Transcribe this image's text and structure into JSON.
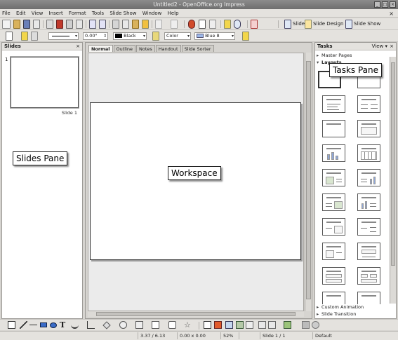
{
  "window": {
    "title": "Untitled2 - OpenOffice.org Impress",
    "buttons": [
      "_",
      "□",
      "×"
    ]
  },
  "menu": {
    "items": [
      "File",
      "Edit",
      "View",
      "Insert",
      "Format",
      "Tools",
      "Slide Show",
      "Window",
      "Help"
    ],
    "close_doc": "×"
  },
  "toolbar1": {
    "slide_label": "Slide",
    "slide_design_label": "Slide Design",
    "slide_show_label": "Slide Show"
  },
  "toolbar2": {
    "line_width": "0.00\"",
    "line_color": "Black",
    "area_style": "Color",
    "area_color": "Blue 8"
  },
  "slides_pane": {
    "title": "Slides",
    "close": "×",
    "thumb_number": "1",
    "thumb_label": "Slide 1"
  },
  "edit_tabs": [
    "Normal",
    "Outline",
    "Notes",
    "Handout",
    "Slide Sorter"
  ],
  "tasks_pane": {
    "title": "Tasks",
    "view": "View ▾",
    "close": "×",
    "sections": {
      "master_pages": "Master Pages",
      "layouts": "Layouts",
      "custom_animation": "Custom Animation",
      "slide_transition": "Slide Transition"
    }
  },
  "annotations": {
    "slides_pane": "Slides Pane",
    "workspace": "Workspace",
    "tasks_pane": "Tasks Pane"
  },
  "status": {
    "position": "3.37 / 6.13",
    "size": "0.00 x 0.00",
    "zoom": "52%",
    "slide": "Slide 1 / 1",
    "layout": "Default"
  },
  "colors": {
    "accent": "#d04a2a",
    "area_color_swatch": "#9db8e8",
    "black_swatch": "#000000"
  }
}
